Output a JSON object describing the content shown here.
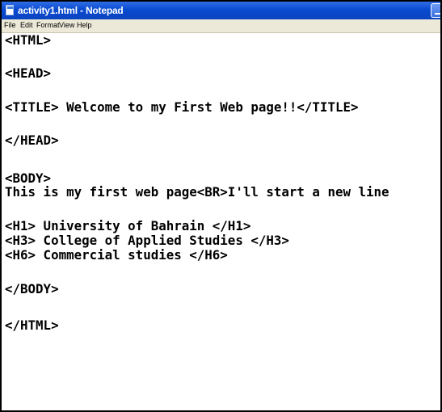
{
  "window": {
    "title": "activity1.html - Notepad"
  },
  "menubar": {
    "items": [
      "File",
      "Edit",
      "Format",
      "View",
      "Help"
    ]
  },
  "editor": {
    "lines": [
      "<HTML>",
      "<HEAD>",
      "<TITLE> Welcome to my First Web page!!</TITLE>",
      "</HEAD>",
      "<BODY>",
      "This is my first web page<BR>I'll start a new line",
      "<H1> University of Bahrain </H1>",
      "<H3> College of Applied Studies </H3>",
      "<H6> Commercial studies </H6>",
      "</BODY>",
      "</HTML>"
    ]
  }
}
